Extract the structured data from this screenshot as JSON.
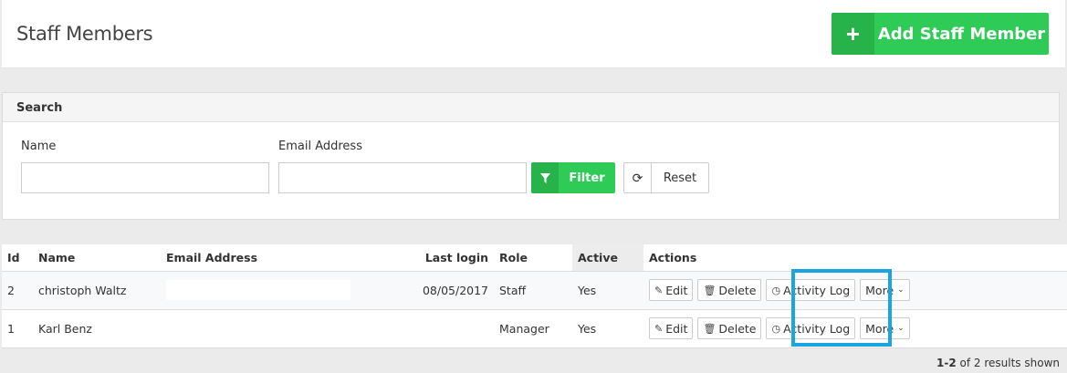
{
  "header": {
    "title": "Staff Members",
    "add_button": {
      "icon": "plus-icon",
      "label": "Add Staff Member"
    }
  },
  "search": {
    "title": "Search",
    "name_label": "Name",
    "name_value": "",
    "email_label": "Email Address",
    "email_value": "",
    "filter_label": "Filter",
    "reset_label": "Reset"
  },
  "table": {
    "columns": [
      "Id",
      "Name",
      "Email Address",
      "Last login",
      "Role",
      "Active",
      "Actions"
    ],
    "rows": [
      {
        "id": "2",
        "name": "christoph Waltz",
        "email": "",
        "last_login": "08/05/2017",
        "role": "Staff",
        "active": "Yes"
      },
      {
        "id": "1",
        "name": "Karl Benz",
        "email": "",
        "last_login": "",
        "role": "Manager",
        "active": "Yes"
      }
    ],
    "actions": {
      "edit": "Edit",
      "delete": "Delete",
      "activity_log": "Activity Log",
      "more": "More"
    }
  },
  "footer": {
    "range": "1-2",
    "summary": "of 2 results shown"
  },
  "colors": {
    "primary_green": "#2ecc56",
    "green_dark": "#27b34a",
    "highlight_blue": "#1aa4e0"
  }
}
